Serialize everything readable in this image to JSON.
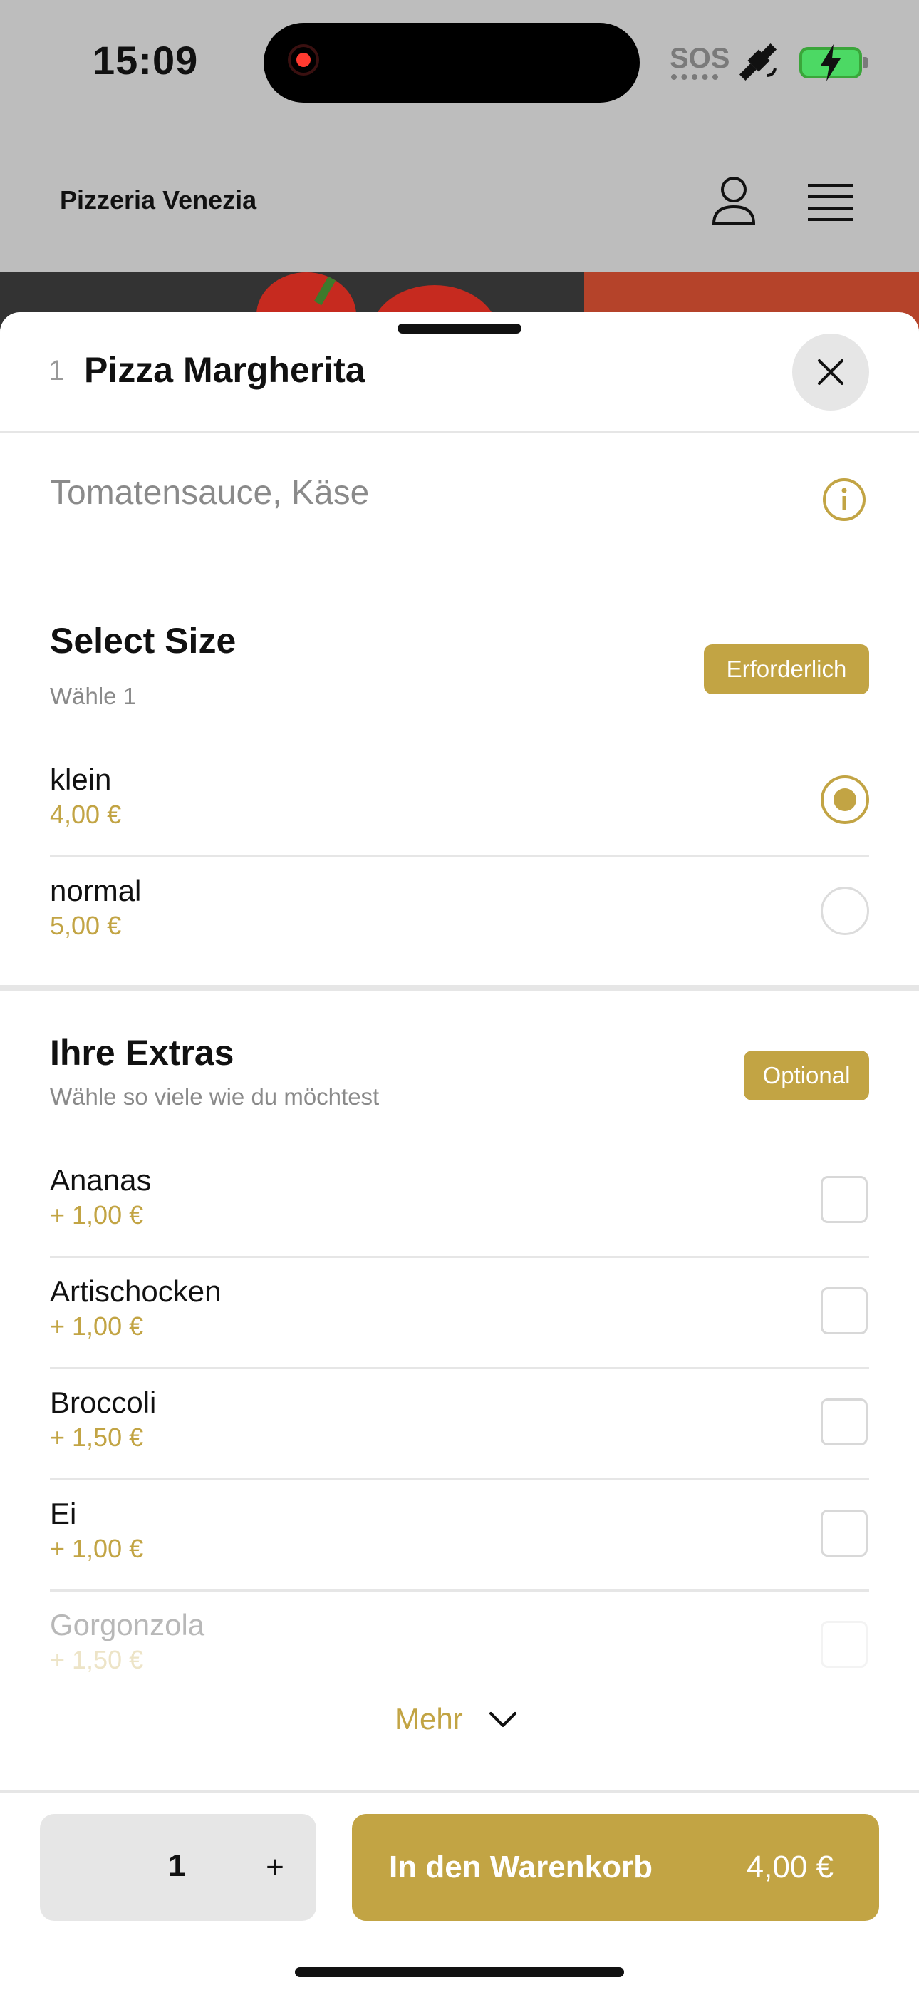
{
  "status_bar": {
    "time": "15:09",
    "sos": "SOS"
  },
  "header": {
    "brand": "Pizzeria Venezia"
  },
  "sheet": {
    "qty_prefix": "1",
    "title": "Pizza Margherita",
    "description": "Tomatensauce, Käse",
    "size_section": {
      "title": "Select Size",
      "subtitle": "Wähle 1",
      "badge": "Erforderlich",
      "options": [
        {
          "name": "klein",
          "price": "4,00 €",
          "selected": true
        },
        {
          "name": "normal",
          "price": "5,00 €",
          "selected": false
        }
      ]
    },
    "extras_section": {
      "title": "Ihre Extras",
      "subtitle": "Wähle so viele wie du möchtest",
      "badge": "Optional",
      "items": [
        {
          "name": "Ananas",
          "price": "+ 1,00 €"
        },
        {
          "name": "Artischocken",
          "price": "+ 1,00 €"
        },
        {
          "name": "Broccoli",
          "price": "+ 1,50 €"
        },
        {
          "name": "Ei",
          "price": "+ 1,00 €"
        },
        {
          "name": "Gorgonzola",
          "price": "+ 1,50 €"
        }
      ]
    },
    "more_label": "Mehr"
  },
  "bottom_bar": {
    "quantity": "1",
    "plus": "+",
    "add_to_cart": "In den Warenkorb",
    "total": "4,00 €"
  },
  "colors": {
    "accent": "#c2a444",
    "overlay": "#bdbdbd"
  },
  "icons": [
    "user-icon",
    "menu-icon",
    "close-icon",
    "info-icon",
    "chevron-down-icon"
  ]
}
